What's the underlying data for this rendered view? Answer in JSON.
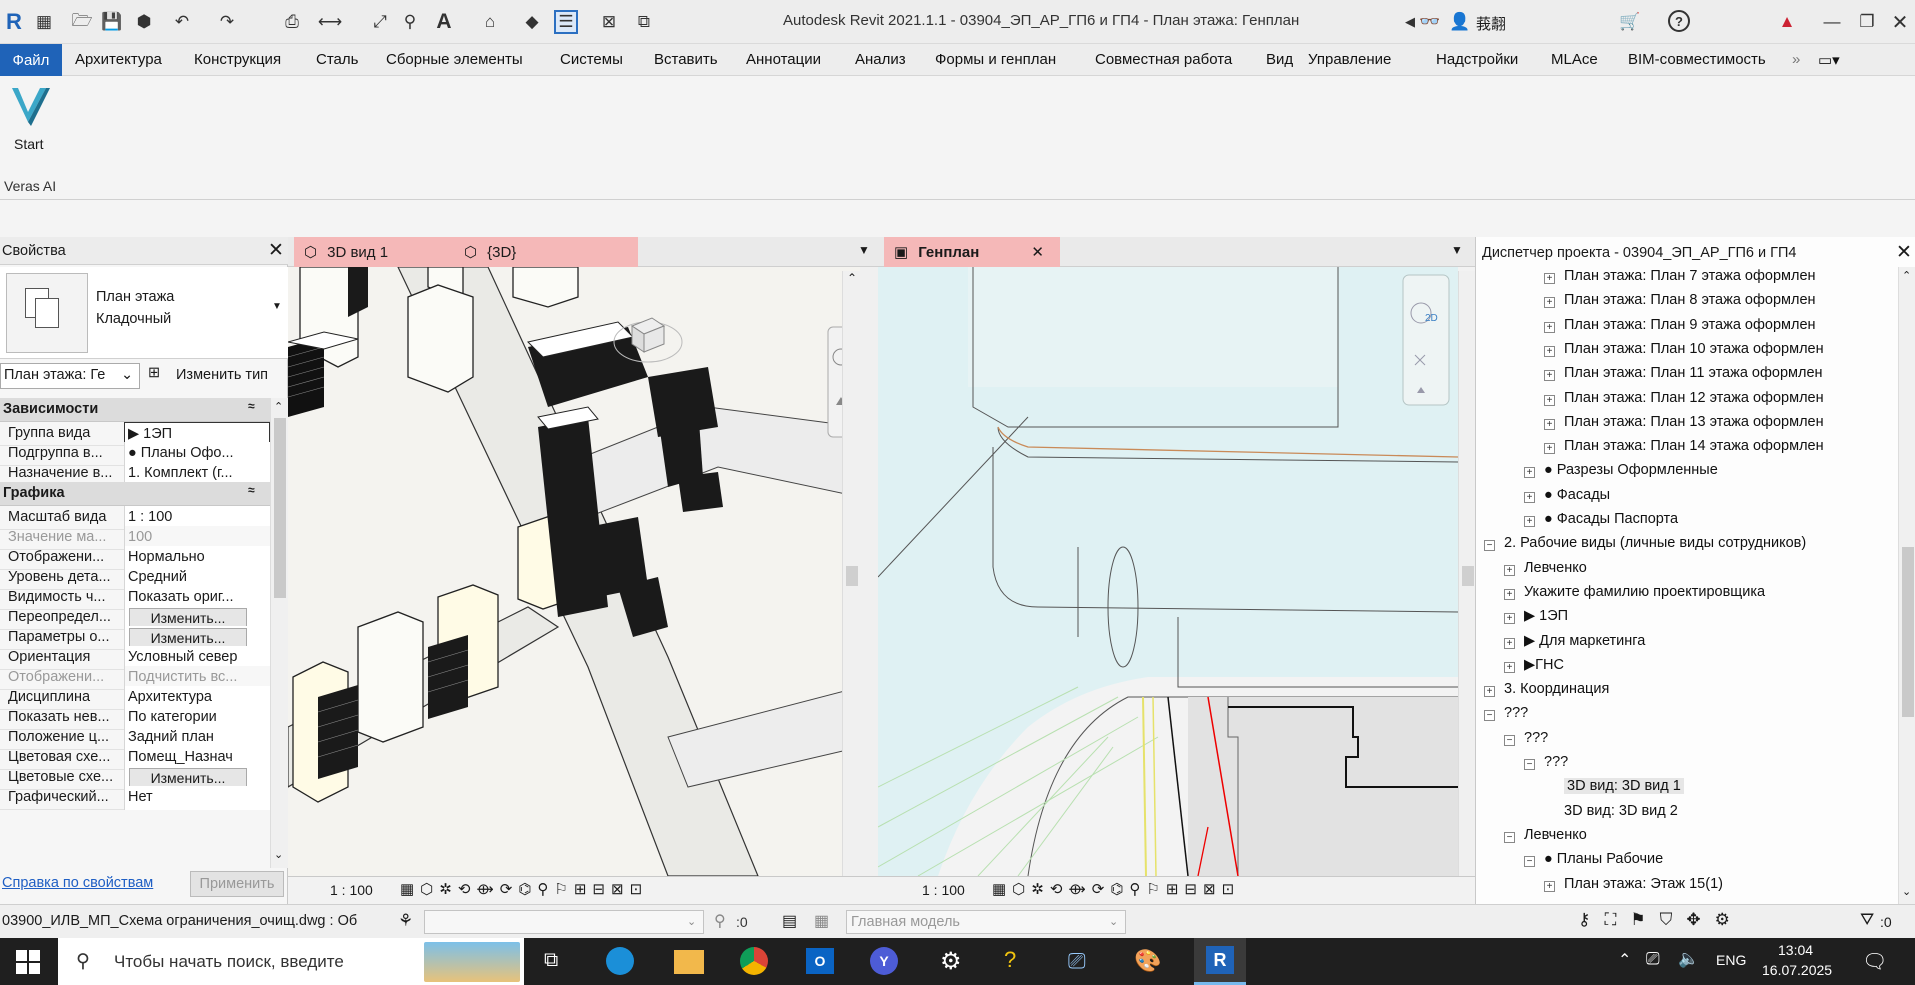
{
  "app": {
    "title": "Autodesk Revit 2021.1.1 - 03904_ЭП_АР_ГП6 и ГП4 - План этажа: Генплан",
    "user": "莪𢡡翿"
  },
  "menu": [
    "Файл",
    "Архитектура",
    "Конструкция",
    "Сталь",
    "Сборные элементы",
    "Системы",
    "Вставить",
    "Аннотации",
    "Анализ",
    "Формы и генплан",
    "Совместная работа",
    "Вид",
    "Управление",
    "Надстройки",
    "MLAce",
    "BIM-совместимость"
  ],
  "ribbon": {
    "button_label": "Start",
    "panel_label": "Veras AI"
  },
  "properties": {
    "title": "Свойства",
    "type_line1": "План этажа",
    "type_line2": "Кладочный",
    "selector": "План этажа: Ге",
    "edit_type": "Изменить тип",
    "cat1": "Зависимости",
    "cat2": "Графика",
    "rows": [
      {
        "k": "Группа вида",
        "v": "▶ 1ЭП"
      },
      {
        "k": "Подгруппа в...",
        "v": "● Планы Офо..."
      },
      {
        "k": "Назначение в...",
        "v": "1. Комплект (г..."
      },
      {
        "k": "Масштаб вида",
        "v": "1 : 100"
      },
      {
        "k": "Значение ма...",
        "v": "100"
      },
      {
        "k": "Отображени...",
        "v": "Нормально"
      },
      {
        "k": "Уровень дета...",
        "v": "Средний"
      },
      {
        "k": "Видимость ч...",
        "v": "Показать ориг..."
      },
      {
        "k": "Переопредел...",
        "v": "Изменить..."
      },
      {
        "k": "Параметры о...",
        "v": "Изменить..."
      },
      {
        "k": "Ориентация",
        "v": "Условный север"
      },
      {
        "k": "Отображени...",
        "v": "Подчистить вс..."
      },
      {
        "k": "Дисциплина",
        "v": "Архитектура"
      },
      {
        "k": "Показать нев...",
        "v": "По категории"
      },
      {
        "k": "Положение ц...",
        "v": "Задний план"
      },
      {
        "k": "Цветовая схе...",
        "v": "Помещ_Назнач"
      },
      {
        "k": "Цветовые схе...",
        "v": "Изменить..."
      },
      {
        "k": "Графический...",
        "v": "Нет"
      }
    ],
    "help_link": "Справка по свойствам",
    "apply": "Применить"
  },
  "view1": {
    "tab1": "3D вид 1",
    "tab2": "{3D}",
    "scale": "1 : 100"
  },
  "view2": {
    "tab": "Генплан",
    "scale": "1 : 100"
  },
  "browser": {
    "title": "Диспетчер проекта - 03904_ЭП_АР_ГП6 и ГП4",
    "items": [
      "План этажа: План 7 этажа оформлен",
      "План этажа: План 8 этажа оформлен",
      "План этажа: План 9 этажа оформлен",
      "План этажа: План 10 этажа оформлен",
      "План этажа: План 11 этажа оформлен",
      "План этажа: План 12 этажа оформлен",
      "План этажа: План 13 этажа оформлен",
      "План этажа: План 14 этажа оформлен",
      "● Разрезы Оформленные",
      "● Фасады",
      "● Фасады Паспорта",
      "2. Рабочие виды (личные виды сотрудников)",
      "Левченко",
      "Укажите фамилию проектировщика",
      "▶ 1ЭП",
      "▶ Для маркетинга",
      "▶ГНС",
      "3. Координация",
      "???",
      "???",
      "???",
      "3D вид: 3D вид 1",
      "3D вид: 3D вид 2",
      "Левченко",
      "● Планы Рабочие",
      "План этажа: Этаж 15(1)"
    ]
  },
  "statusbar": {
    "left": "03900_ИЛВ_МП_Схема ограничения_очищ.dwg : Об",
    "count": ":0",
    "model": "Главная модель",
    "filter": ":0"
  },
  "taskbar": {
    "search": "Чтобы начать поиск, введите",
    "lang": "ENG",
    "time": "13:04",
    "date": "16.07.2025"
  }
}
